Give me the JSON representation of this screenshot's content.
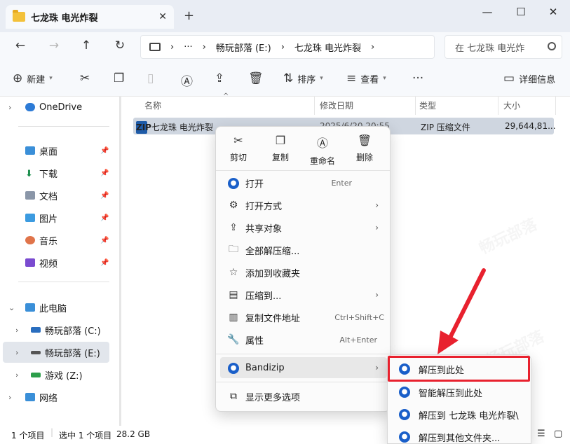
{
  "window": {
    "tab_title": "七龙珠 电光炸裂",
    "tab_close": "✕",
    "new_tab": "+",
    "minimize": "—",
    "maximize": "☐",
    "close": "✕"
  },
  "nav": {
    "back": "←",
    "forward": "→",
    "up": "↑",
    "refresh": "↻"
  },
  "address": {
    "sep1": "›",
    "ellipsis": "···",
    "sep2": "›",
    "crumbs": [
      "畅玩部落 (E:)",
      "七龙珠 电光炸裂"
    ],
    "sep3": "›",
    "sep4": "›"
  },
  "search": {
    "placeholder": "在 七龙珠 电光炸"
  },
  "toolbar": {
    "new_label": "新建",
    "sort_label": "排序",
    "view_label": "查看",
    "more": "···",
    "details_label": "详细信息"
  },
  "sidebar": {
    "items": [
      {
        "label": "OneDrive",
        "icon": "cloud-icon"
      },
      {
        "label": "桌面",
        "icon": "desktop-icon"
      },
      {
        "label": "下载",
        "icon": "download-icon"
      },
      {
        "label": "文档",
        "icon": "document-icon"
      },
      {
        "label": "图片",
        "icon": "pictures-icon"
      },
      {
        "label": "音乐",
        "icon": "music-icon"
      },
      {
        "label": "视频",
        "icon": "video-icon"
      },
      {
        "label": "此电脑",
        "icon": "pc-icon"
      },
      {
        "label": "畅玩部落 (C:)",
        "icon": "drive-icon"
      },
      {
        "label": "畅玩部落 (E:)",
        "icon": "drive-icon"
      },
      {
        "label": "游戏 (Z:)",
        "icon": "drive-icon"
      },
      {
        "label": "网络",
        "icon": "network-icon"
      }
    ]
  },
  "columns": {
    "name": "名称",
    "modified": "修改日期",
    "type": "类型",
    "size": "大小"
  },
  "file": {
    "name": "七龙珠 电光炸裂",
    "modified": "2025/6/20 20:55",
    "type": "ZIP 压缩文件",
    "size": "29,644,81..."
  },
  "context_menu": {
    "quick": {
      "cut": "剪切",
      "copy": "复制",
      "rename": "重命名",
      "delete": "删除"
    },
    "items": [
      {
        "label": "打开",
        "shortcut": "Enter",
        "icon": "bandizip-icon"
      },
      {
        "label": "打开方式",
        "shortcut": "",
        "icon": "open-with-icon"
      },
      {
        "label": "共享对象",
        "shortcut": "",
        "icon": "share-icon"
      },
      {
        "label": "全部解压缩...",
        "shortcut": "",
        "icon": "extract-icon"
      },
      {
        "label": "添加到收藏夹",
        "shortcut": "",
        "icon": "star-icon"
      },
      {
        "label": "压缩到...",
        "shortcut": "",
        "icon": "compress-icon"
      },
      {
        "label": "复制文件地址",
        "shortcut": "Ctrl+Shift+C",
        "icon": "copy-path-icon"
      },
      {
        "label": "属性",
        "shortcut": "Alt+Enter",
        "icon": "properties-icon"
      },
      {
        "label": "Bandizip",
        "shortcut": "",
        "icon": "bandizip-icon"
      },
      {
        "label": "显示更多选项",
        "shortcut": "",
        "icon": "more-options-icon"
      }
    ],
    "arrow": "›"
  },
  "submenu": {
    "items": [
      "解压到此处",
      "智能解压到此处",
      "解压到 七龙珠 电光炸裂\\",
      "解压到其他文件夹..."
    ]
  },
  "status": {
    "count": "1 个项目",
    "selected": "选中 1 个项目",
    "size": "28.2 GB"
  },
  "colors": {
    "accent": "#1a5fc9",
    "highlight_box": "#e8212e",
    "selected_row": "#cfd6e0"
  }
}
